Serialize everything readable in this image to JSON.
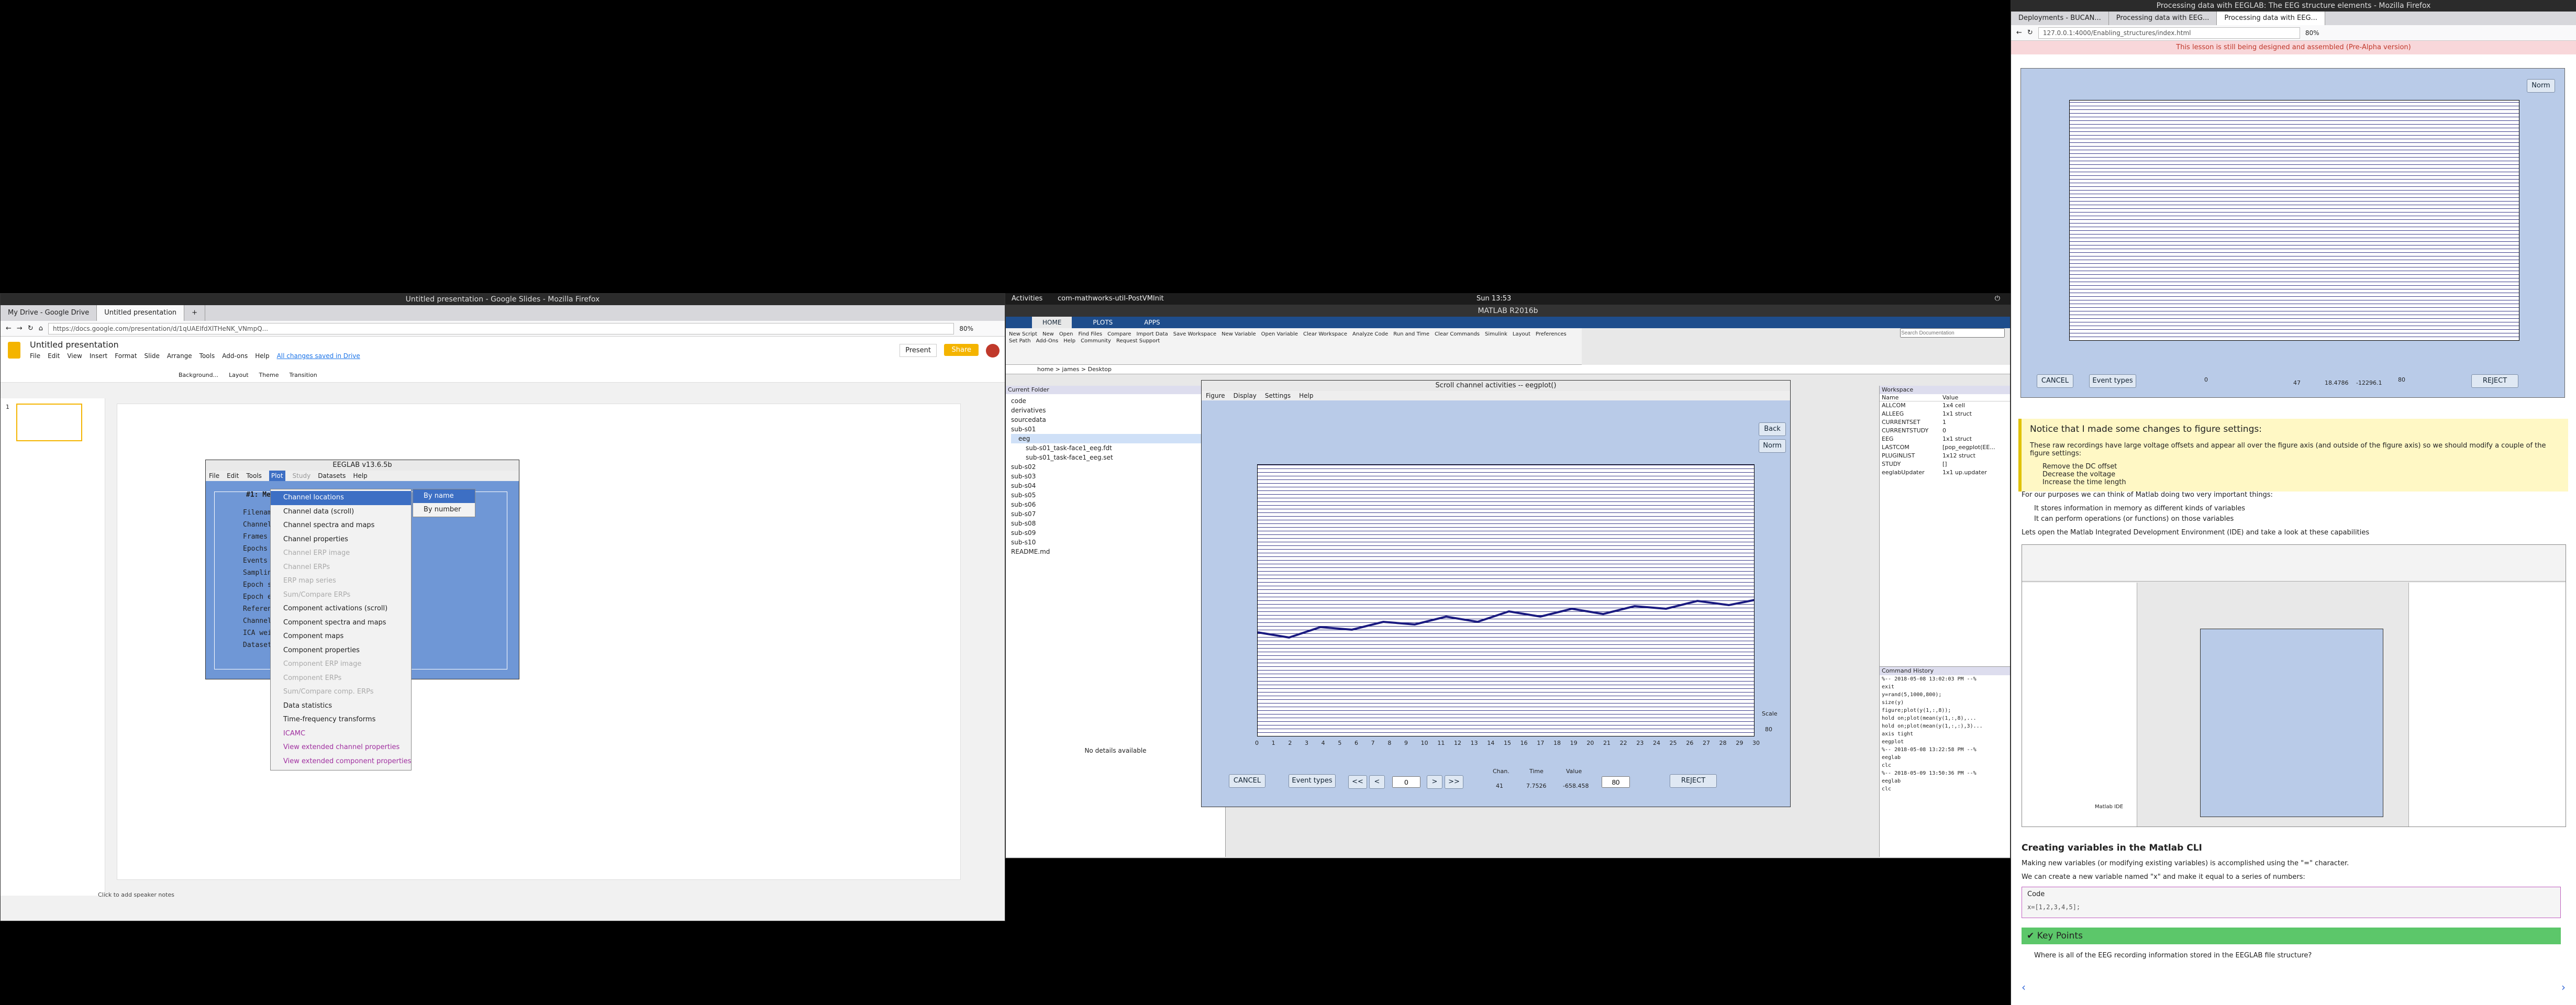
{
  "firefox_left": {
    "title": "Untitled presentation - Google Slides - Mozilla Firefox",
    "tabs": [
      "My Drive - Google Drive",
      "Untitled presentation"
    ],
    "url": "https://docs.google.com/presentation/d/1qUAEIfdXlTHeNK_VNmpQ...",
    "zoom": "80%",
    "doc_title": "Untitled presentation",
    "menus": [
      "File",
      "Edit",
      "View",
      "Insert",
      "Format",
      "Slide",
      "Arrange",
      "Tools",
      "Add-ons",
      "Help"
    ],
    "saved_note": "All changes saved in Drive",
    "present": "Present",
    "share": "Share",
    "toolbar_items": [
      "Background...",
      "Layout",
      "Theme",
      "Transition"
    ],
    "speaker_notes": "Click to add speaker notes",
    "slide_number": "1"
  },
  "eeglab": {
    "title": "EEGLAB v13.6.5b",
    "menus": [
      "File",
      "Edit",
      "Tools",
      "Plot",
      "Study",
      "Datasets",
      "Help"
    ],
    "panel_title": "#1: Mer...",
    "labels": [
      "Filename",
      "Channels",
      "Frames p",
      "Epochs",
      "Events",
      "Sampling",
      "Epoch st",
      "Epoch en",
      "Referenc",
      "Channel",
      "ICA weig",
      "Dataset"
    ],
    "plot_menu": [
      "Channel locations",
      "Channel data (scroll)",
      "Channel spectra and maps",
      "Channel properties",
      "Channel ERP image",
      "Channel ERPs",
      "ERP map series",
      "Sum/Compare ERPs",
      "Component activations (scroll)",
      "Component spectra and maps",
      "Component maps",
      "Component properties",
      "Component ERP image",
      "Component ERPs",
      "Sum/Compare comp. ERPs",
      "Data statistics",
      "Time-frequency transforms",
      "ICAMC",
      "View extended channel properties",
      "View extended component properties"
    ],
    "submenu": [
      "By name",
      "By number"
    ]
  },
  "topbar": {
    "activities": "Activities",
    "app": "com-mathworks-util-PostVMInit",
    "clock": "Sun 13:53"
  },
  "matlab": {
    "title": "MATLAB R2016b",
    "tabs": [
      "HOME",
      "PLOTS",
      "APPS"
    ],
    "toolstrip": [
      "New Script",
      "New",
      "Open",
      "Find Files",
      "Compare",
      "Import Data",
      "Save Workspace",
      "New Variable",
      "Open Variable",
      "Clear Workspace",
      "Analyze Code",
      "Run and Time",
      "Clear Commands",
      "Simulink",
      "Layout",
      "Preferences",
      "Set Path",
      "Add-Ons",
      "Help",
      "Community",
      "Request Support"
    ],
    "search_placeholder": "Search Documentation",
    "path": "home > james > Desktop",
    "current_folder": "Current Folder",
    "files": [
      "code",
      "derivatives",
      "sourcedata",
      "sub-s01",
      "eeg",
      "sub-s01_task-face1_eeg.fdt",
      "sub-s01_task-face1_eeg.set",
      "sub-s02",
      "sub-s03",
      "sub-s04",
      "sub-s05",
      "sub-s06",
      "sub-s07",
      "sub-s08",
      "sub-s09",
      "sub-s10",
      "README.md"
    ],
    "details": "No details available",
    "workspace": "Workspace",
    "ws_cols": [
      "Name",
      "Value"
    ],
    "ws_rows": [
      [
        "ALLCOM",
        "1x4 cell"
      ],
      [
        "ALLEEG",
        "1x1 struct"
      ],
      [
        "CURRENTSET",
        "1"
      ],
      [
        "CURRENTSTUDY",
        "0"
      ],
      [
        "EEG",
        "1x1 struct"
      ],
      [
        "LASTCOM",
        "[pop_eegplot(EE..."
      ],
      [
        "PLUGINLIST",
        "1x12 struct"
      ],
      [
        "STUDY",
        "[]"
      ],
      [
        "eeglabUpdater",
        "1x1 up.updater"
      ]
    ],
    "cmd_history": "Command History",
    "history_lines": [
      "%-- 2018-05-08 13:02:03 PM --%",
      "exit",
      "y=rand(5,1000,800);",
      "size(y)",
      "figure;plot(y(1,:,8));",
      "hold on;plot(mean(y(1,:,8),...",
      "hold on;plot(mean(y(1,:,:),3)...",
      "axis tight",
      "eegplot",
      "%-- 2018-05-08 13:22:58 PM --%",
      "eeglab",
      "clc",
      "%-- 2018-05-09 13:50:36 PM --%",
      "eeglab",
      "clc"
    ]
  },
  "scroll_window": {
    "title": "Scroll channel activities -- eegplot()",
    "menus": [
      "Figure",
      "Display",
      "Settings",
      "Help"
    ],
    "x_ticks": [
      "0",
      "1",
      "2",
      "3",
      "4",
      "5",
      "6",
      "7",
      "8",
      "9",
      "10",
      "11",
      "12",
      "13",
      "14",
      "15",
      "16",
      "17",
      "18",
      "19",
      "20",
      "21",
      "22",
      "23",
      "24",
      "25",
      "26",
      "27",
      "28",
      "29",
      "30"
    ],
    "scale_label": "Scale",
    "scale_value": "80",
    "buttons": [
      "Back",
      "Norm"
    ],
    "cancel": "CANCEL",
    "event_types": "Event types",
    "nav_left": [
      "<<",
      "<"
    ],
    "nav_right": [
      ">",
      ">>"
    ],
    "position": "0",
    "chan_label": "Chan.",
    "time_label": "Time",
    "value_label": "Value",
    "chan": "41",
    "time": "7.7526",
    "value": "-658.458",
    "scale_input": "80",
    "reject": "REJECT"
  },
  "firefox_right": {
    "title": "Processing data with EEGLAB: The EEG structure elements - Mozilla Firefox",
    "tabs": [
      "Deployments - BUCAN...",
      "Processing data with EEG...",
      "Processing data with EEG..."
    ],
    "url": "127.0.0.1:4000/Enabling_structures/index.html",
    "zoom": "80%",
    "banner": "This lesson is still being designed and assembled (Pre-Alpha version)",
    "callout_title": "Notice that I made some changes to figure settings:",
    "callout_intro": "These raw recordings have large voltage offsets and appear all over the figure axis (and outside of the figure axis) so we should modify a couple of the figure settings:",
    "callout_items": [
      "Remove the DC offset",
      "Decrease the voltage",
      "Increase the time length"
    ],
    "para1": "For our purposes we can think of Matlab doing two very important things:",
    "para1_items": [
      "It stores information in memory as different kinds of variables",
      "It can perform operations (or functions) on those variables"
    ],
    "para2": "Lets open the Matlab Integrated Development Environment (IDE) and take a look at these capabilities",
    "fig_caption": "Matlab IDE",
    "h_creating": "Creating variables in the Matlab CLI",
    "para3": "Making new variables (or modifying existing variables) is accomplished using the \"=\" character.",
    "para4": "We can create a new variable named \"x\" and make it equal to a series of numbers:",
    "code_label": "Code",
    "code": "x=[1,2,3,4,5];",
    "keypoints": "Key Points",
    "keypoint": "Where is all of the EEG recording information stored in the EEGLAB file structure?",
    "embedded_chan": "47",
    "embedded_time": "18.4786",
    "embedded_value": "-12296.1",
    "embedded_scale": "80",
    "embedded_cancel": "CANCEL",
    "embedded_events": "Event types",
    "embedded_reject": "REJECT",
    "embedded_pos": "0",
    "embedded_btn": "Norm"
  },
  "colors": {
    "accent": "#1a73e8",
    "eeg_blue": "#2a2a8a",
    "callout": "#fff8c5",
    "keypoints": "#5cc76a"
  }
}
